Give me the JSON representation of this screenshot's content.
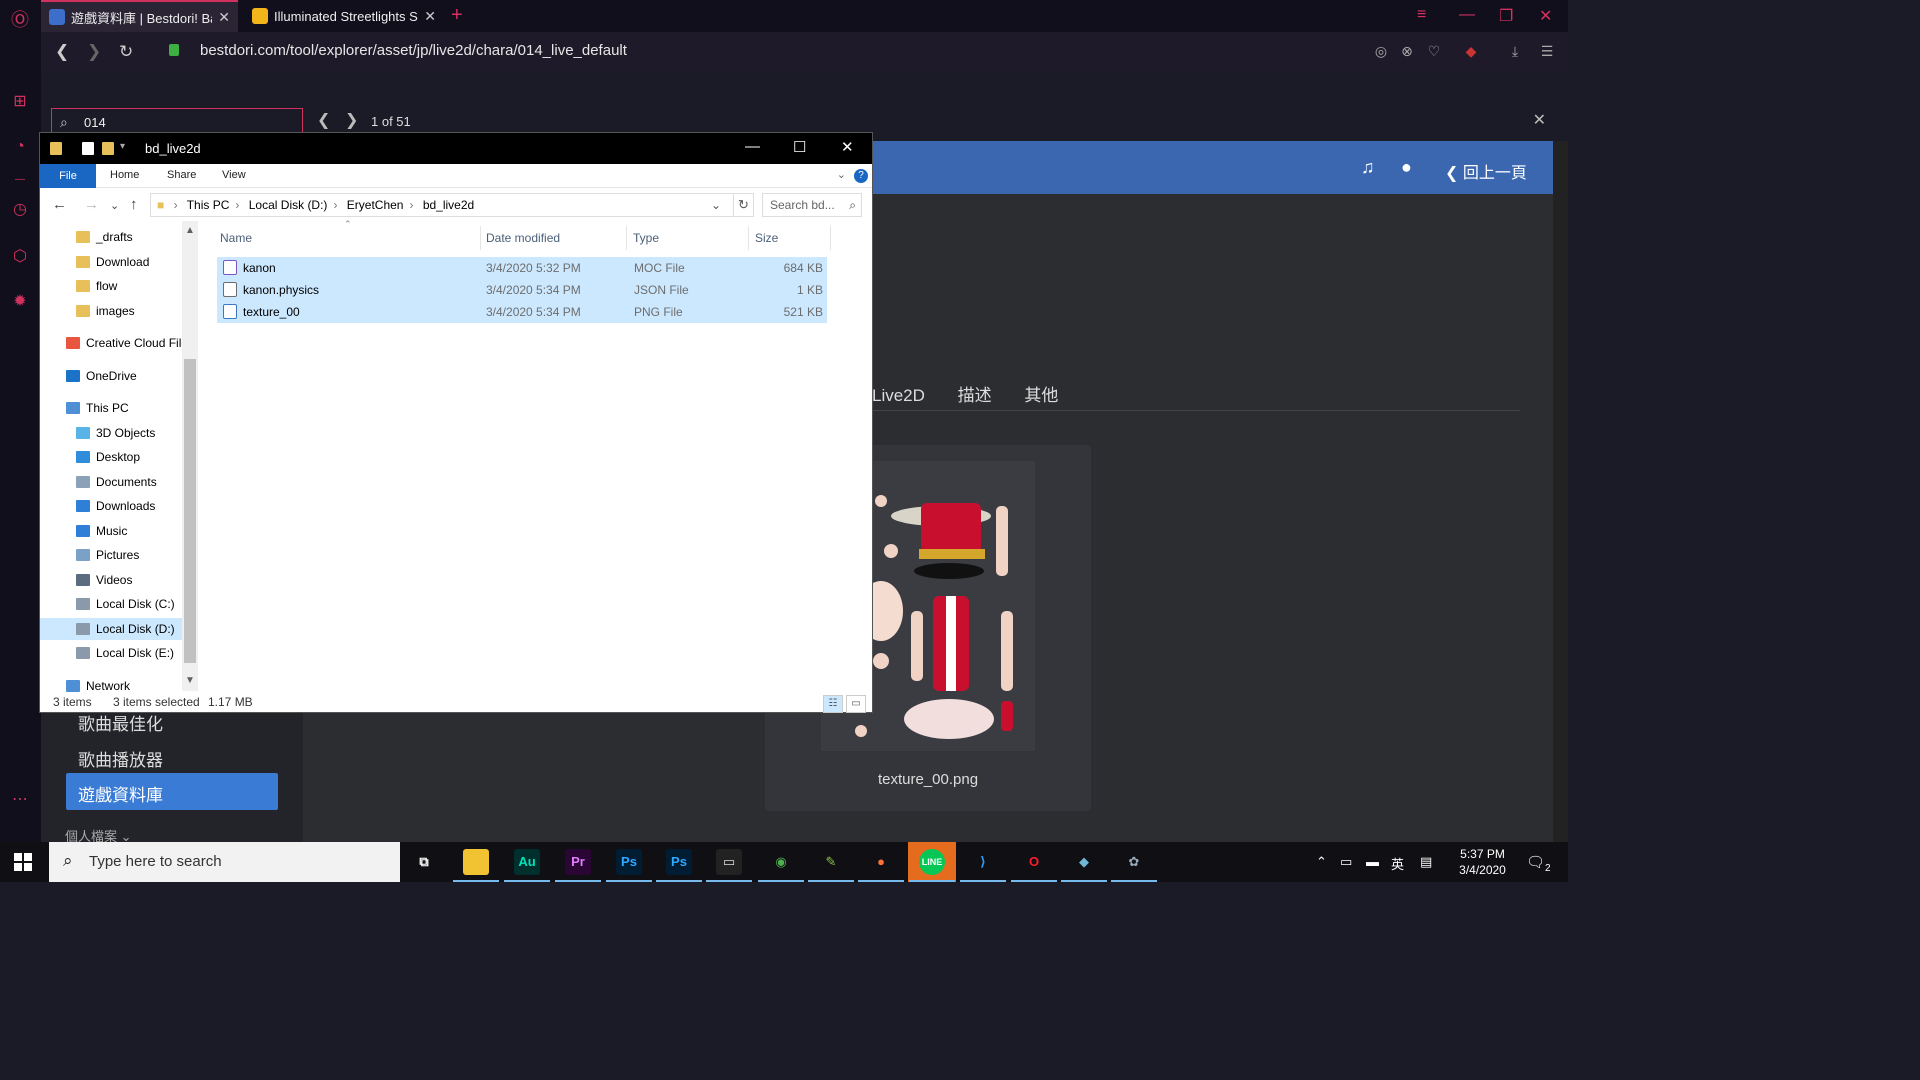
{
  "browser": {
    "tabs": [
      {
        "title": "遊戲資料庫 | Bestdori! BanG Dream!",
        "active": true
      },
      {
        "title": "Illuminated Streetlights Stream",
        "active": false
      }
    ],
    "url": "bestdori.com/tool/explorer/asset/jp/live2d/chara/014_live_default",
    "find": {
      "query": "014",
      "count": "1 of 51"
    }
  },
  "page": {
    "nav_back": "回上一頁",
    "sidebar": {
      "items": [
        "歌曲最佳化",
        "歌曲播放器"
      ],
      "active": "遊戲資料庫",
      "profile": "個人檔案"
    },
    "tabs": [
      "Live2D",
      "描述",
      "其他"
    ],
    "asset_name": "texture_00.png"
  },
  "explorer": {
    "title": "bd_live2d",
    "ribbon": {
      "file": "File",
      "home": "Home",
      "share": "Share",
      "view": "View"
    },
    "breadcrumb": [
      "This PC",
      "Local Disk (D:)",
      "EryetChen",
      "bd_live2d"
    ],
    "search_placeholder": "Search bd...",
    "nav": [
      {
        "label": "_drafts",
        "color": "#e8c05a"
      },
      {
        "label": "Download",
        "color": "#e8c05a"
      },
      {
        "label": "flow",
        "color": "#e8c05a"
      },
      {
        "label": "images",
        "color": "#e8c05a"
      },
      {
        "label": "Creative Cloud Files",
        "color": "#e8563f"
      },
      {
        "label": "OneDrive",
        "color": "#1a73c9"
      },
      {
        "label": "This PC",
        "color": "#4f8fd6"
      },
      {
        "label": "3D Objects",
        "color": "#5ab3e6"
      },
      {
        "label": "Desktop",
        "color": "#2f8ddb"
      },
      {
        "label": "Documents",
        "color": "#8aa1b8"
      },
      {
        "label": "Downloads",
        "color": "#2f7fd8"
      },
      {
        "label": "Music",
        "color": "#2f7fd8"
      },
      {
        "label": "Pictures",
        "color": "#7ba1c7"
      },
      {
        "label": "Videos",
        "color": "#5b6b80"
      },
      {
        "label": "Local Disk (C:)",
        "color": "#8a9aaa"
      },
      {
        "label": "Local Disk (D:)",
        "color": "#8a9aaa"
      },
      {
        "label": "Local Disk (E:)",
        "color": "#8a9aaa"
      },
      {
        "label": "Network",
        "color": "#4f8fd6"
      }
    ],
    "columns": {
      "name": "Name",
      "date": "Date modified",
      "type": "Type",
      "size": "Size"
    },
    "files": [
      {
        "name": "kanon",
        "date": "3/4/2020 5:32 PM",
        "type": "MOC File",
        "size": "684 KB"
      },
      {
        "name": "kanon.physics",
        "date": "3/4/2020 5:34 PM",
        "type": "JSON File",
        "size": "1 KB"
      },
      {
        "name": "texture_00",
        "date": "3/4/2020 5:34 PM",
        "type": "PNG File",
        "size": "521 KB"
      }
    ],
    "status": {
      "items": "3 items",
      "selected": "3 items selected",
      "size": "1.17 MB"
    }
  },
  "taskbar": {
    "search_placeholder": "Type here to search",
    "apps": [
      {
        "name": "task-view",
        "label": "⧉",
        "bg": "transparent",
        "fg": "#fff"
      },
      {
        "name": "file-explorer",
        "label": "",
        "bg": "#f1c232",
        "fg": "#000"
      },
      {
        "name": "audition",
        "label": "Au",
        "bg": "#00302e",
        "fg": "#00e4bb"
      },
      {
        "name": "premiere",
        "label": "Pr",
        "bg": "#2a0634",
        "fg": "#e27bff"
      },
      {
        "name": "photoshop-1",
        "label": "Ps",
        "bg": "#001d34",
        "fg": "#31a8ff"
      },
      {
        "name": "photoshop-2",
        "label": "Ps",
        "bg": "#001d34",
        "fg": "#31a8ff"
      },
      {
        "name": "terminal",
        "label": "▭",
        "bg": "#222",
        "fg": "#ddd"
      },
      {
        "name": "chrome",
        "label": "◉",
        "bg": "transparent",
        "fg": "#4caf50"
      },
      {
        "name": "notepad",
        "label": "✎",
        "bg": "transparent",
        "fg": "#8bc34a"
      },
      {
        "name": "firefox",
        "label": "●",
        "bg": "transparent",
        "fg": "#ff7139"
      },
      {
        "name": "line",
        "label": "LINE",
        "bg": "#06c755",
        "fg": "#fff"
      },
      {
        "name": "vscode",
        "label": "⟩",
        "bg": "transparent",
        "fg": "#2b9cf2"
      },
      {
        "name": "opera",
        "label": "O",
        "bg": "transparent",
        "fg": "#ff1b2d"
      },
      {
        "name": "app-blue",
        "label": "◆",
        "bg": "transparent",
        "fg": "#6fb8d8"
      },
      {
        "name": "app-paint",
        "label": "✿",
        "bg": "transparent",
        "fg": "#9ab"
      }
    ],
    "tray_lang": "英",
    "time": "5:37 PM",
    "date": "3/4/2020",
    "notifications": "2"
  },
  "colors": {
    "opera_red": "#d1325f",
    "page_nav_blue": "#3a67b0",
    "explorer_blue": "#1a67c3",
    "selection": "#cce8ff"
  }
}
